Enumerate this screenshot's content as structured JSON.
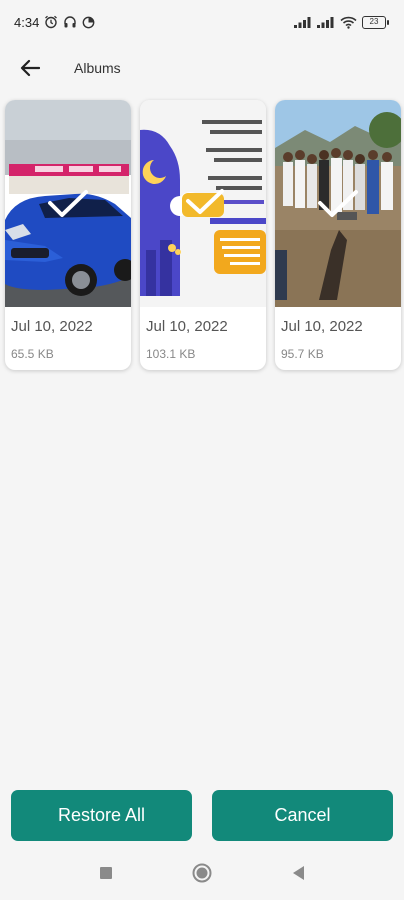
{
  "status_bar": {
    "time": "4:34",
    "battery": "23",
    "icons": [
      "alarm-icon",
      "headphones-icon",
      "data-saver-icon",
      "signal-icon",
      "signal-icon",
      "wifi-icon",
      "battery-icon"
    ]
  },
  "app_bar": {
    "title": "Albums",
    "back_icon": "arrow-left-icon"
  },
  "items": [
    {
      "date": "Jul 10, 2022",
      "size": "65.5 KB",
      "selected": true,
      "thumb": "blue-car-photo"
    },
    {
      "date": "Jul 10, 2022",
      "size": "103.1 KB",
      "selected": true,
      "thumb": "arabic-greeting-graphic"
    },
    {
      "date": "Jul 10, 2022",
      "size": "95.7 KB",
      "selected": true,
      "thumb": "group-photo-outdoors"
    }
  ],
  "actions": {
    "restore_label": "Restore All",
    "cancel_label": "Cancel"
  },
  "nav_bar": {
    "icons": [
      "recents-square-icon",
      "home-circle-icon",
      "back-triangle-icon"
    ]
  },
  "colors": {
    "accent": "#12897a",
    "background": "#f5f5f5"
  }
}
